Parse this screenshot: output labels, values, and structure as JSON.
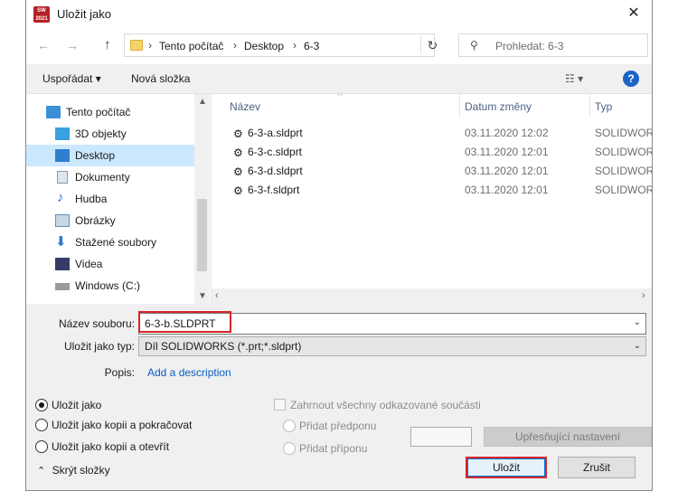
{
  "window": {
    "title": "Uložit jako",
    "close_glyph": "✕",
    "app_icon_text": "SW 2021"
  },
  "navigation": {
    "back_glyph": "←",
    "forward_glyph": "→",
    "up_glyph": "↑",
    "breadcrumb": [
      "Tento počítač",
      "Desktop",
      "6-3"
    ],
    "breadcrumb_sep": "›",
    "refresh_glyph": "↻",
    "search_placeholder": "Prohledat: 6-3"
  },
  "toolbar": {
    "organize": "Uspořádat ▾",
    "new_folder": "Nová složka",
    "view_glyph": "☷ ▾",
    "help": "?"
  },
  "sidebar": {
    "items": [
      {
        "label": "Tento počítač",
        "icon": "computer-icon",
        "color": "#3b8fd6"
      },
      {
        "label": "3D objekty",
        "icon": "cube-icon",
        "color": "#3aa0e0"
      },
      {
        "label": "Desktop",
        "icon": "desktop-icon",
        "color": "#2f7fd0",
        "selected": true
      },
      {
        "label": "Dokumenty",
        "icon": "document-icon",
        "color": "#8a9bb0"
      },
      {
        "label": "Hudba",
        "icon": "music-icon",
        "color": "#2a6fd0"
      },
      {
        "label": "Obrázky",
        "icon": "image-icon",
        "color": "#6b8fb0"
      },
      {
        "label": "Stažené soubory",
        "icon": "download-icon",
        "color": "#2a7ad0"
      },
      {
        "label": "Videa",
        "icon": "video-icon",
        "color": "#3a3a6a"
      },
      {
        "label": "Windows (C:)",
        "icon": "drive-icon",
        "color": "#8a8a8a"
      }
    ]
  },
  "file_list": {
    "columns": {
      "name": "Název",
      "date": "Datum změny",
      "type": "Typ"
    },
    "rows": [
      {
        "name": "6-3-a.sldprt",
        "date": "03.11.2020 12:02",
        "type": "SOLIDWORKS"
      },
      {
        "name": "6-3-c.sldprt",
        "date": "03.11.2020 12:01",
        "type": "SOLIDWORKS"
      },
      {
        "name": "6-3-d.sldprt",
        "date": "03.11.2020 12:01",
        "type": "SOLIDWORKS"
      },
      {
        "name": "6-3-f.sldprt",
        "date": "03.11.2020 12:01",
        "type": "SOLIDWORKS"
      }
    ]
  },
  "form": {
    "filename_label": "Název souboru:",
    "filename_value": "6-3-b.SLDPRT",
    "filetype_label": "Uložit jako typ:",
    "filetype_value": "Díl SOLIDWORKS (*.prt;*.sldprt)",
    "description_label": "Popis:",
    "description_link": "Add a description"
  },
  "options": {
    "save_as": "Uložit jako",
    "save_as_copy_continue": "Uložit jako kopii a pokračovat",
    "save_as_copy_open": "Uložit jako kopii a otevřít",
    "include_refs": "Zahrnout všechny odkazované součásti",
    "add_prefix": "Přidat předponu",
    "add_suffix": "Přidat příponu",
    "advanced": "Upřesňující nastavení"
  },
  "footer": {
    "hide_folders": "Skrýt složky",
    "save": "Uložit",
    "cancel": "Zrušit"
  }
}
